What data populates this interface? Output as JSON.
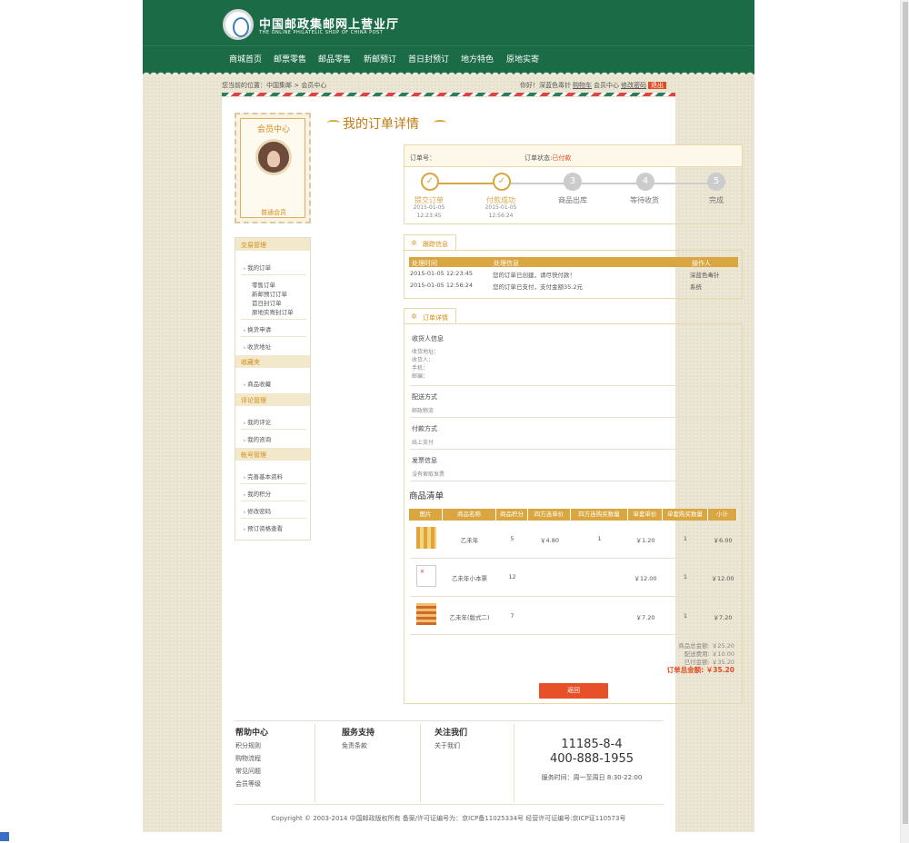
{
  "header": {
    "logo_title": "中国邮政集邮网上营业厅",
    "logo_subtitle": "THE ONLINE PHILATELIC SHOP OF CHINA POST"
  },
  "nav": [
    "商城首页",
    "邮票零售",
    "邮品零售",
    "新邮预订",
    "首日封预订",
    "地方特色",
    "原地实寄"
  ],
  "breadcrumb": "您当前的位置：中国集邮 > 会员中心",
  "user_bar": {
    "greeting": "你好！",
    "username": "深蓝色毒针",
    "cart": "购物车",
    "member": "会员中心",
    "change_password": "修改密码",
    "logout": "退出"
  },
  "member_card": {
    "title": "会员中心",
    "level": "普通会员"
  },
  "sidebar": {
    "groups": [
      {
        "title": "交易管理"
      },
      {
        "title": "收藏夹"
      },
      {
        "title": "评论管理"
      },
      {
        "title": "帐号管理"
      }
    ],
    "items": [
      "我的订单",
      "换货申请",
      "收货地址",
      "商品收藏",
      "我的评论",
      "我的咨询",
      "完善基本资料",
      "我的积分",
      "修改密码",
      "预订资格查看"
    ],
    "subitems": [
      "零售订单",
      "新邮预订订单",
      "首日封订单",
      "原地实寄封订单"
    ]
  },
  "page_title": "我的订单详情",
  "order_status": {
    "order_no_label": "订单号：",
    "status_label": "订单状态:",
    "status_value": "已付款"
  },
  "steps": [
    {
      "num": "✓",
      "label": "提交订单",
      "date": "2015-01-05",
      "time": "12:23:45"
    },
    {
      "num": "✓",
      "label": "付款成功",
      "date": "2015-01-05",
      "time": "12:56:24"
    },
    {
      "num": "3",
      "label": "商品出库",
      "date": "",
      "time": ""
    },
    {
      "num": "4",
      "label": "等待收货",
      "date": "",
      "time": ""
    },
    {
      "num": "5",
      "label": "完成",
      "date": "",
      "time": ""
    }
  ],
  "tracking": {
    "tab": "跟踪信息",
    "headers": [
      "处理时间",
      "处理信息",
      "操作人"
    ],
    "rows": [
      [
        "2015-01-05 12:23:45",
        "您的订单已创建，请尽快付款！",
        "深蓝色毒针"
      ],
      [
        "2015-01-05 12:56:24",
        "您的订单已支付，支付金额35.2元",
        "系统"
      ]
    ]
  },
  "detail": {
    "tab": "订单详情",
    "receiver_h": "收货人信息",
    "receiver_fields": [
      "收货地址：",
      "收货人：",
      "手机：",
      "邮编："
    ],
    "shipping_h": "配送方式",
    "shipping_v": "邮政物流",
    "payment_h": "付款方式",
    "payment_v": "线上支付",
    "invoice_h": "发票信息",
    "invoice_v": "没有索取发票",
    "goods_h": "商品清单"
  },
  "goods": {
    "headers": [
      "图片",
      "商品名称",
      "商品积分",
      "四方连单价",
      "四方连购买数量",
      "单套单价",
      "单套购买数量",
      "小计"
    ],
    "rows": [
      {
        "name": "乙未年",
        "points": "5",
        "quad_price": "￥4.80",
        "quad_qty": "1",
        "unit_price": "￥1.20",
        "unit_qty": "1",
        "subtotal": "￥6.00"
      },
      {
        "name": "乙未年小本票",
        "points": "12",
        "quad_price": "",
        "quad_qty": "",
        "unit_price": "￥12.00",
        "unit_qty": "1",
        "subtotal": "￥12.00"
      },
      {
        "name": "乙未年(版式二)",
        "points": "7",
        "quad_price": "",
        "quad_qty": "",
        "unit_price": "￥7.20",
        "unit_qty": "1",
        "subtotal": "￥7.20"
      }
    ]
  },
  "summary": {
    "goods_total": "商品总金额: ￥25.20",
    "shipping": "配送费用: ￥10.00",
    "paid": "已付金额: ￥35.20",
    "order_total": "订单总金额: ￥35.20"
  },
  "back_button": "返回",
  "footer": {
    "help_h": "帮助中心",
    "help_links": [
      "积分规则",
      "购物流程",
      "常见问题",
      "会员等级"
    ],
    "service_h": "服务支持",
    "service_links": [
      "免责条款"
    ],
    "about_h": "关注我们",
    "about_links": [
      "关于我们"
    ],
    "phone1": "11185-8-4",
    "phone2": "400-888-1955",
    "hours": "服务时间：周一至周日 8:30-22:00",
    "copyright": "Copyright © 2003-2014 中国邮政版权所有 备案/许可证编号为：京ICP备11025334号 经营许可证编号:京ICP证110573号"
  },
  "colors": {
    "header_green": "#1b6b47",
    "accent_gold": "#d9a640",
    "accent_red": "#e14d24"
  }
}
